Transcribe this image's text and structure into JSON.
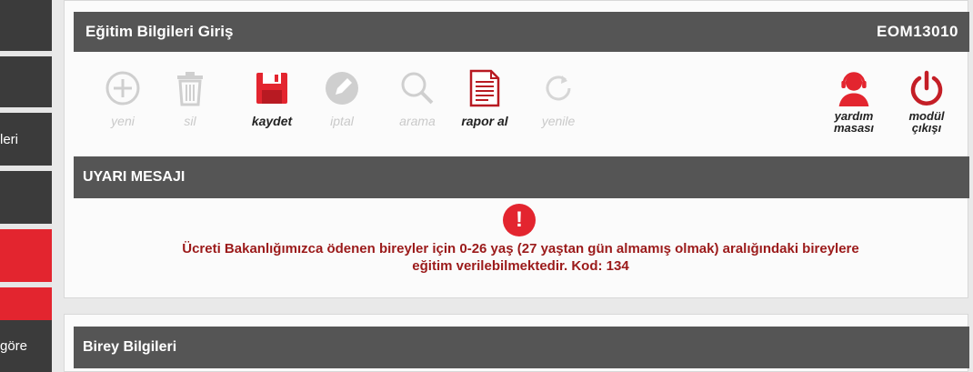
{
  "sidebar": {
    "items": [
      {
        "label": ""
      },
      {
        "label": ""
      },
      {
        "label": "leri"
      },
      {
        "label": ""
      },
      {
        "label": ""
      },
      {
        "label": ""
      },
      {
        "label": "göre"
      }
    ]
  },
  "header": {
    "title": "Eğitim Bilgileri Giriş",
    "code": "EOM13010"
  },
  "toolbar": {
    "new_label": "yeni",
    "delete_label": "sil",
    "save_label": "kaydet",
    "cancel_label": "iptal",
    "search_label": "arama",
    "report_label": "rapor al",
    "refresh_label": "yenile",
    "help_line1": "yardım",
    "help_line2": "masası",
    "exit_line1": "modül",
    "exit_line2": "çıkışı"
  },
  "warning": {
    "title": "UYARI MESAJI",
    "icon_text": "!",
    "line1": "Ücreti Bakanlığımızca ödenen bireyler için 0-26 yaş (27 yaştan gün almamış olmak) aralığındaki bireylere",
    "line2": "eğitim verilebilmektedir. Kod: 134"
  },
  "section2": {
    "title": "Birey Bilgileri"
  },
  "colors": {
    "accent": "#e3252f",
    "bar": "#555555",
    "alert_text": "#9b1a1a",
    "disabled": "#c9c9c9"
  }
}
